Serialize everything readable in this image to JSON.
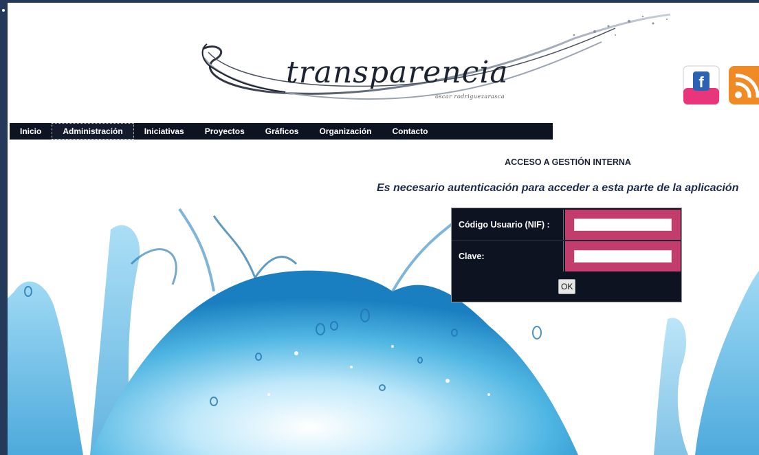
{
  "header": {
    "logo_text": "transparencia",
    "logo_subtitle": "oscar rodriguezarasca",
    "social": [
      {
        "name": "facebook",
        "glyph": "f",
        "color": "#e8357b"
      },
      {
        "name": "rss",
        "color": "#f08a24"
      }
    ]
  },
  "nav": {
    "items": [
      {
        "label": "Inicio"
      },
      {
        "label": "Administración",
        "active": true
      },
      {
        "label": "Iniciativas"
      },
      {
        "label": "Proyectos"
      },
      {
        "label": "Gráficos"
      },
      {
        "label": "Organización"
      },
      {
        "label": "Contacto"
      }
    ]
  },
  "main": {
    "title": "ACCESO A GESTIÓN INTERNA",
    "message": "Es necesario autenticación para acceder a esta parte de la aplicación"
  },
  "login": {
    "user_label": "Código Usuario (NIF) :",
    "user_value": "",
    "password_label": "Clave:",
    "password_value": "",
    "submit_label": "OK"
  },
  "colors": {
    "page_border": "#25395a",
    "nav_bg": "#0d1321",
    "field_cell": "#c23c6c",
    "water": "#3aa6d8"
  }
}
